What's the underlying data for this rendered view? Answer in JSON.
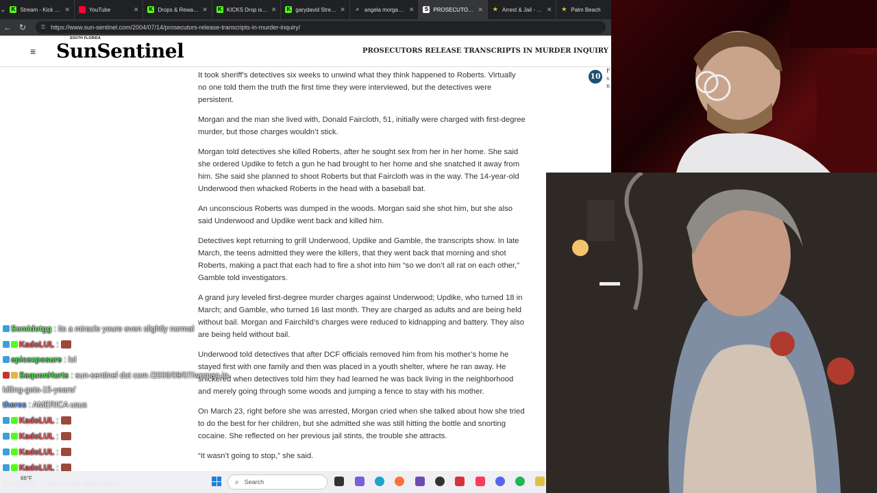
{
  "browser": {
    "tabs": [
      {
        "label": "Stream - Kick Dash",
        "icon": "kick-icon",
        "favicon_text": "K",
        "kind": "kick"
      },
      {
        "label": "YouTube",
        "icon": "youtube-icon",
        "favicon_text": "",
        "kind": "yt"
      },
      {
        "label": "Drops & Rewards",
        "icon": "kick-icon",
        "favicon_text": "K",
        "kind": "kick"
      },
      {
        "label": "KICKS Drop is here",
        "icon": "kick-icon",
        "favicon_text": "K",
        "kind": "kick"
      },
      {
        "label": "garydavid Stream",
        "icon": "kick-icon",
        "favicon_text": "K",
        "kind": "kick"
      },
      {
        "label": "angela morgan w",
        "icon": "search-icon",
        "favicon_text": "⌕",
        "kind": "search"
      },
      {
        "label": "PROSECUTORS RE",
        "icon": "sun-sentinel-icon",
        "favicon_text": "S",
        "kind": "s",
        "active": true
      },
      {
        "label": "Arrest & Jail - Palm",
        "icon": "star-icon",
        "favicon_text": "★",
        "kind": "star"
      },
      {
        "label": "Palm Beach",
        "icon": "star-icon",
        "favicon_text": "★",
        "kind": "star"
      }
    ],
    "url": "https://www.sun-sentinel.com/2004/07/14/prosecutors-release-transcripts-in-murder-inquiry/"
  },
  "site": {
    "logo_text": "SunSentinel",
    "logo_sub": "SOUTH FLORIDA",
    "header_title": "PROSECUTORS RELEASE TRANSCRIPTS IN MURDER INQUIRY",
    "side_badge": "10",
    "side_text": "F\ns\nn"
  },
  "article": {
    "paragraphs": [
      "It took sheriff’s detectives six weeks to unwind what they think happened to Roberts. Virtually no one told them the truth the first time they were interviewed, but the detectives were persistent.",
      "Morgan and the man she lived with, Donald Faircloth, 51, initially were charged with first-degree murder, but those charges wouldn’t stick.",
      "Morgan told detectives she killed Roberts, after he sought sex from her in her home. She said she ordered Updike to fetch a gun he had brought to her home and she snatched it away from him. She said she planned to shoot Roberts but that Faircloth was in the way. The 14-year-old Underwood then whacked Roberts in the head with a baseball bat.",
      "An unconscious Roberts was dumped in the woods. Morgan said she shot him, but she also said Underwood and Updike went back and killed him.",
      "Detectives kept returning to grill Underwood, Updike and Gamble, the transcripts show. In late March, the teens admitted they were the killers, that they went back that morning and shot Roberts, making a pact that each had to fire a shot into him “so we don’t all rat on each other,” Gamble told investigators.",
      "A grand jury leveled first-degree murder charges against Underwood; Updike, who turned 18 in March; and Gamble, who turned 16 last month. They are charged as adults and are being held without bail. Morgan and Fairchild’s charges were reduced to kidnapping and battery. They also are being held without bail.",
      "Underwood told detectives that after DCF officials removed him from his mother’s home he stayed first with one family and then was placed in a youth shelter, where he ran away. He snickered when detectives told him they had learned he was back living in the neighborhood and merely going through some woods and jumping a fence to stay with his mother.",
      "On March 23, right before she was arrested, Morgan cried when she talked about how she tried to do the best for her children, but she admitted she was still hitting the bottle and snorting cocaine. She reflected on her previous jail stints, the trouble she attracts.",
      "“It wasn’t going to stop,” she said."
    ]
  },
  "chat": [
    {
      "user": "Semidotgg",
      "color": "#7ee07e",
      "badges": [
        "b-blue"
      ],
      "text": "its a miracle youre even slightly normal"
    },
    {
      "user": "KadoLUL",
      "color": "#e05a5a",
      "badges": [
        "b-blue",
        "b-green"
      ],
      "text": "",
      "emote": true
    },
    {
      "user": "epicexposure",
      "color": "#4cd65c",
      "badges": [
        "b-blue"
      ],
      "text": "lol"
    },
    {
      "user": "SaquonHurts",
      "color": "#52d852",
      "badges": [
        "b-red",
        "b-gold"
      ],
      "text": "sun-sentinel dot com /2006/09/07/woman-in-"
    },
    {
      "user": "",
      "color": "#ffffff",
      "badges": [],
      "text": "killing-gets-15-years/"
    },
    {
      "user": "theres",
      "color": "#6aa8ff",
      "badges": [],
      "text": "AMERICA usus"
    },
    {
      "user": "KadoLUL",
      "color": "#e05a5a",
      "badges": [
        "b-blue",
        "b-green"
      ],
      "text": "",
      "emote": true
    },
    {
      "user": "KadoLUL",
      "color": "#e05a5a",
      "badges": [
        "b-blue",
        "b-green"
      ],
      "text": "",
      "emote": true
    },
    {
      "user": "KadoLUL",
      "color": "#e05a5a",
      "badges": [
        "b-blue",
        "b-green"
      ],
      "text": "",
      "emote": true
    },
    {
      "user": "KadoLUL",
      "color": "#e05a5a",
      "badges": [
        "b-blue",
        "b-green"
      ],
      "text": "",
      "emote": true
    },
    {
      "user": "twiddix",
      "color": "#ffffff",
      "badges": [
        "b-green"
      ],
      "text": "I don't see your name"
    }
  ],
  "taskbar": {
    "weather": "66°F",
    "search_placeholder": "Search"
  },
  "colors": {
    "accent": "#1b4f72",
    "kick_green": "#53fc18",
    "cam_red": "#5a0a0c"
  }
}
